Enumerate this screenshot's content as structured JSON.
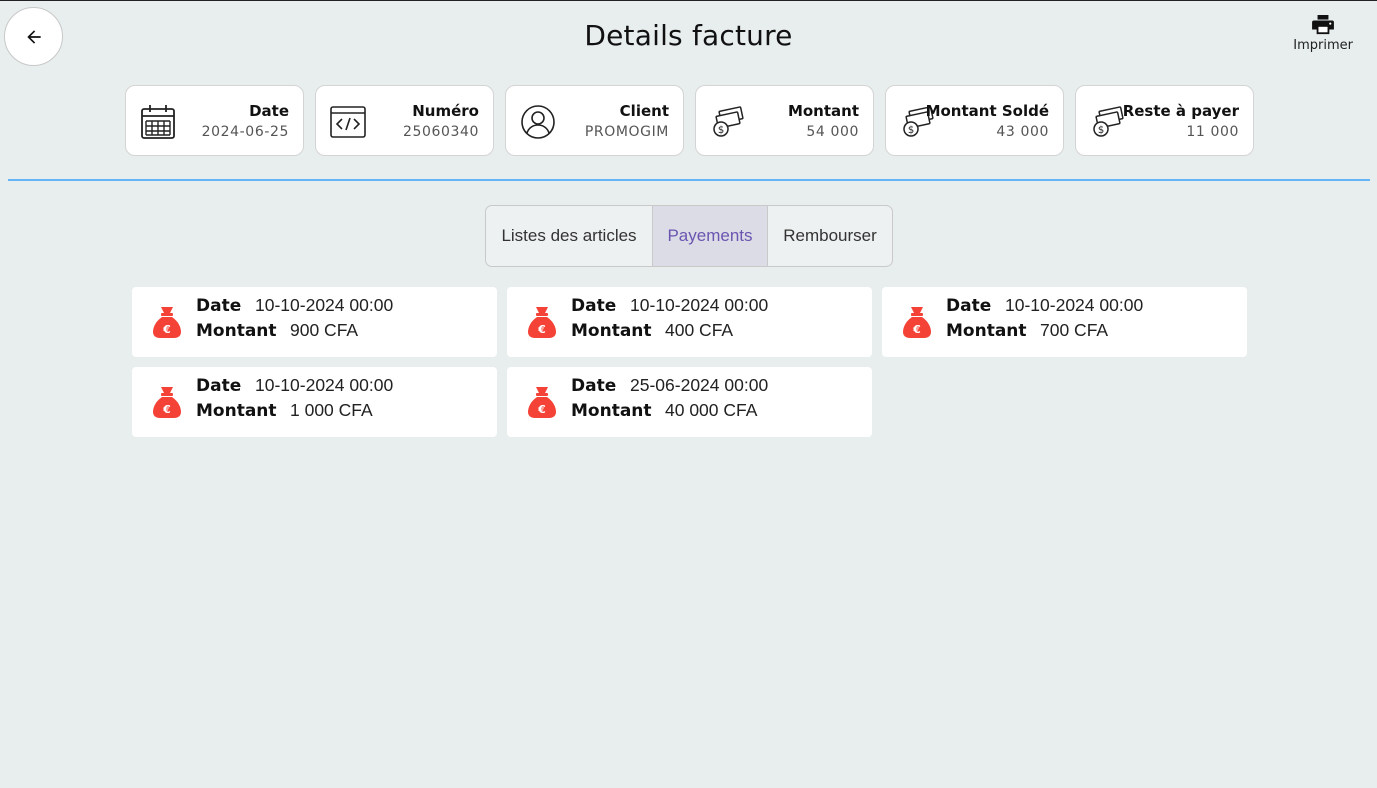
{
  "header": {
    "title": "Details facture",
    "print_label": "Imprimer"
  },
  "info_cards": [
    {
      "label": "Date",
      "value": "2024-06-25",
      "icon": "calendar-icon"
    },
    {
      "label": "Numéro",
      "value": "25060340",
      "icon": "code-icon"
    },
    {
      "label": "Client",
      "value": "PROMOGIM",
      "icon": "user-icon"
    },
    {
      "label": "Montant",
      "value": "54 000",
      "icon": "money-icon"
    },
    {
      "label": "Montant Soldé",
      "value": "43 000",
      "icon": "money-icon"
    },
    {
      "label": "Reste à payer",
      "value": "11 000",
      "icon": "money-icon"
    }
  ],
  "tabs": [
    {
      "label": "Listes des articles",
      "active": false
    },
    {
      "label": "Payements",
      "active": true
    },
    {
      "label": "Rembourser",
      "active": false
    }
  ],
  "payment_labels": {
    "date": "Date",
    "amount": "Montant"
  },
  "payments": [
    {
      "date": "10-10-2024 00:00",
      "amount": "900 CFA"
    },
    {
      "date": "10-10-2024 00:00",
      "amount": "400 CFA"
    },
    {
      "date": "10-10-2024 00:00",
      "amount": "700 CFA"
    },
    {
      "date": "10-10-2024 00:00",
      "amount": "1 000 CFA"
    },
    {
      "date": "25-06-2024 00:00",
      "amount": "40 000 CFA"
    }
  ],
  "colors": {
    "background": "#e8eeee",
    "divider": "#64b5f6",
    "active_tab_text": "#6a55b0",
    "active_tab_bg": "#dcdce6",
    "money_bag": "#f44336"
  }
}
